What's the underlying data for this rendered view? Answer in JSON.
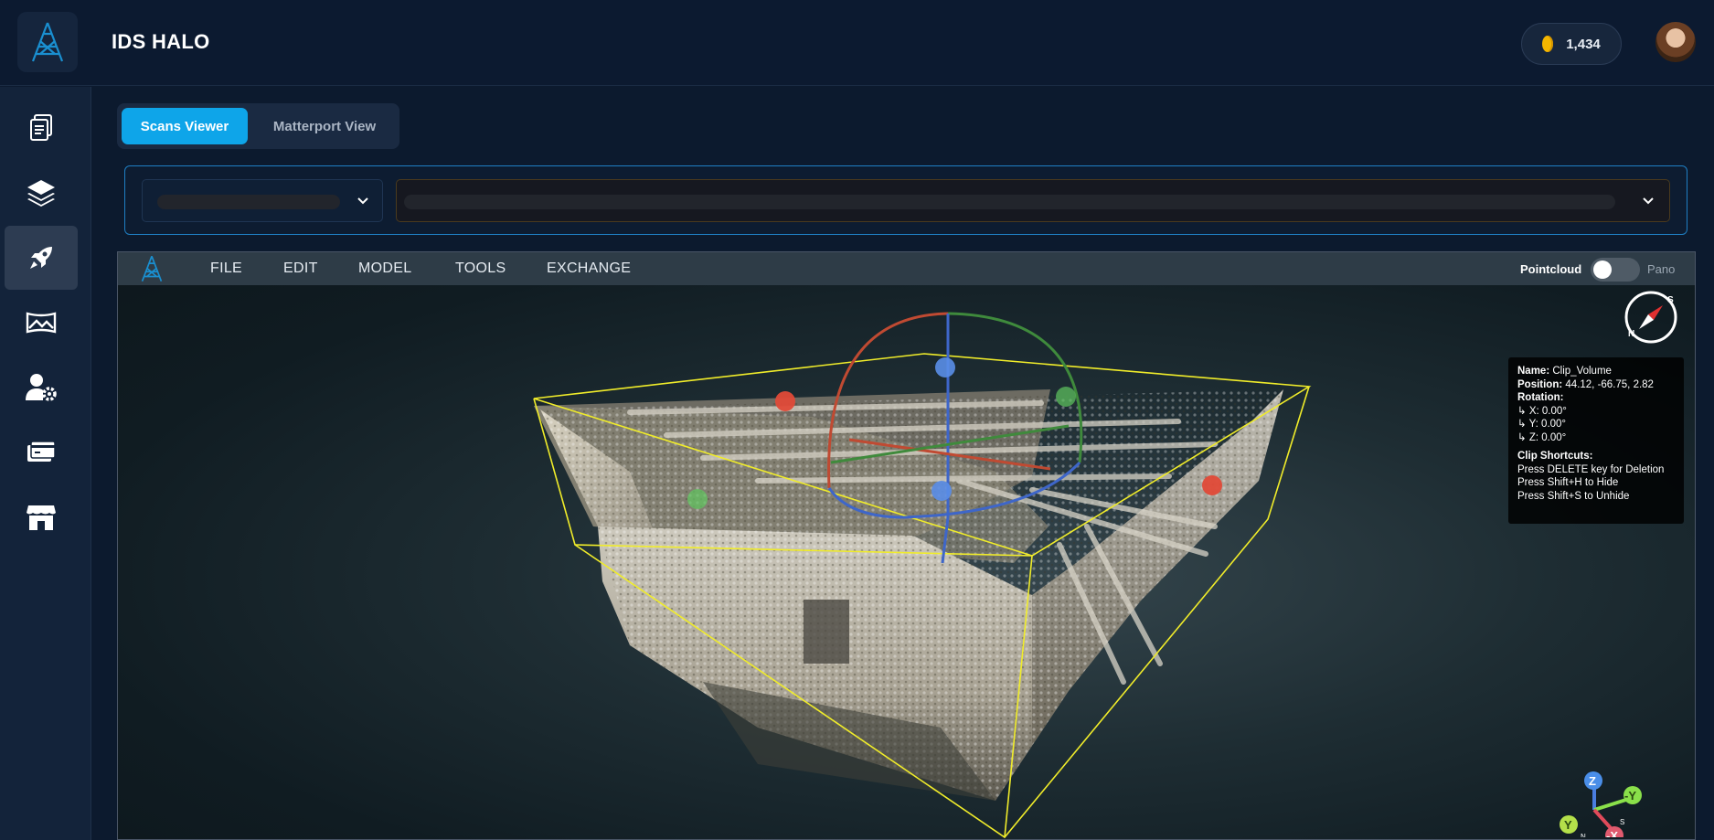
{
  "app": {
    "title": "IDS HALO"
  },
  "header": {
    "coins": "1,434",
    "avatar_icon": "user-avatar-icon",
    "logo_icon": "tower-logo-icon"
  },
  "sidebar": {
    "items": [
      {
        "icon": "documents-icon",
        "active": false
      },
      {
        "icon": "layers-icon",
        "active": false
      },
      {
        "icon": "rocket-icon",
        "active": true
      },
      {
        "icon": "panorama-icon",
        "active": false
      },
      {
        "icon": "user-settings-icon",
        "active": false
      },
      {
        "icon": "credit-card-icon",
        "active": false
      },
      {
        "icon": "store-icon",
        "active": false
      }
    ]
  },
  "tabs": {
    "scans": "Scans Viewer",
    "matterport": "Matterport View"
  },
  "viewer": {
    "menu": {
      "file": "FILE",
      "edit": "EDIT",
      "model": "MODEL",
      "tools": "TOOLS",
      "exchange": "EXCHANGE"
    },
    "pointcloud_label": "Pointcloud",
    "pano_label": "Pano",
    "toggle_on": false,
    "info": {
      "name_label": "Name:",
      "name_value": "Clip_Volume",
      "position_label": "Position:",
      "position_value": "44.12, -66.75, 2.82",
      "rotation_label": "Rotation:",
      "rot_x": "↳ X: 0.00°",
      "rot_y": "↳ Y: 0.00°",
      "rot_z": "↳ Z: 0.00°",
      "shortcuts_label": "Clip Shortcuts:",
      "shortcut_delete": "Press DELETE key for Deletion",
      "shortcut_hide": "Press Shift+H to Hide",
      "shortcut_unhide": "Press Shift+S to Unhide"
    },
    "compass": {
      "letter_n": "N",
      "letter_s": "S"
    },
    "axes": {
      "z": "Z",
      "neg_y": "-Y",
      "y": "Y",
      "neg_x": "-X",
      "n": "N",
      "s": "S"
    }
  },
  "colors": {
    "accent": "#0ea5e9",
    "clip_box": "#f0ec2a",
    "gizmo_red": "#d9453a",
    "gizmo_green": "#3aa350",
    "gizmo_blue": "#3b6fd9"
  }
}
